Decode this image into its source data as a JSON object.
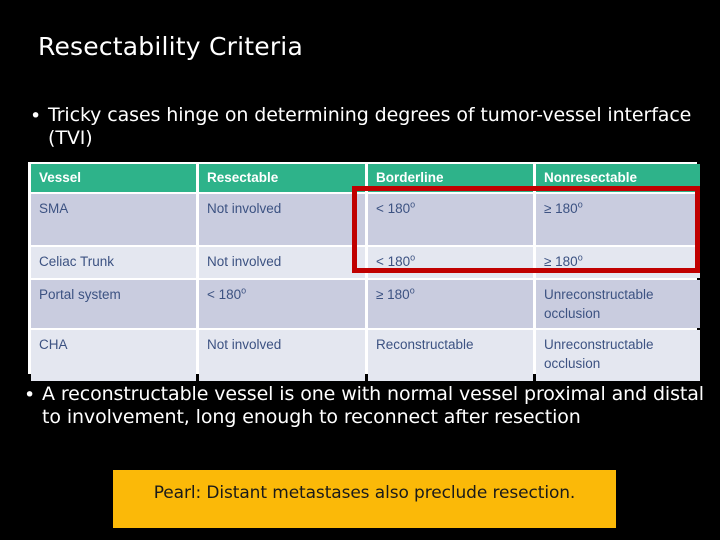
{
  "slide": {
    "title": "Resectability Criteria",
    "background_color": "#000000",
    "text_color": "#FFFFFF"
  },
  "bullets": {
    "marker": "•",
    "top": "Tricky cases hinge on determining degrees of tumor-vessel interface (TVI)",
    "bottom": "A reconstructable vessel is one with normal vessel proximal and distal to involvement, long enough to reconnect after resection"
  },
  "table": {
    "header_color": "#2EB38A",
    "row_dark_color": "#C9CCDF",
    "row_light_color": "#E4E7F0",
    "cell_text_color": "#3C5282",
    "columns": [
      "Vessel",
      "Resectable",
      "Borderline",
      "Nonresectable"
    ],
    "rows": [
      {
        "vessel": "SMA",
        "resectable": "Not involved",
        "borderline_value": "< 180",
        "borderline_unit": "o",
        "nonresectable_value": "≥ 180",
        "nonresectable_unit": "o"
      },
      {
        "vessel": "Celiac Trunk",
        "resectable": "Not involved",
        "borderline_value": "< 180",
        "borderline_unit": "o",
        "nonresectable_value": "≥ 180",
        "nonresectable_unit": "o"
      },
      {
        "vessel": "Portal system",
        "resectable": "< 180",
        "resectable_unit": "o",
        "borderline_value": "≥ 180",
        "borderline_unit": "o",
        "nonresectable_value": "Unreconstructable occlusion",
        "nonresectable_unit": ""
      },
      {
        "vessel": "CHA",
        "resectable": "Not involved",
        "borderline_value": "Reconstructable",
        "borderline_unit": "",
        "nonresectable_value": "Unreconstructable occlusion",
        "nonresectable_unit": ""
      }
    ]
  },
  "annotation": {
    "highlight_color": "#C00000",
    "highlight_description": "red-rectangle-around-borderline-and-nonresectable-of-sma-and-celiac-trunk"
  },
  "pearl": {
    "text": "Pearl: Distant metastases also preclude resection.",
    "background_color": "#FBB908",
    "text_color": "#1A1A1A"
  }
}
